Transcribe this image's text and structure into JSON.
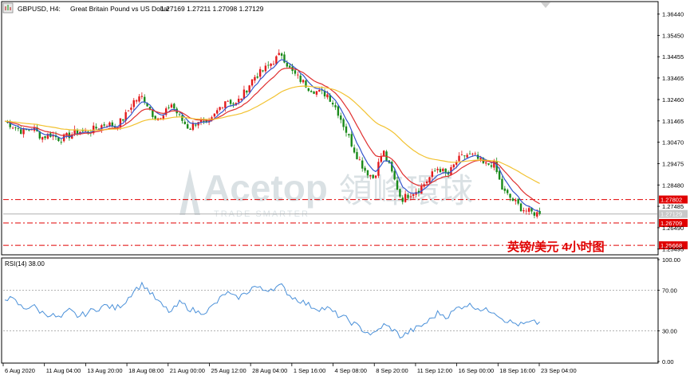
{
  "header": {
    "symbol": "GBPUSD, H4:",
    "description": "Great Britain Pound vs US Dollar",
    "ohlc": "1.27169 1.27211 1.27098 1.27129"
  },
  "watermark": {
    "brand_en": "Acetop",
    "brand_cn": "領峰環球",
    "tagline": "TRADE SMARTER"
  },
  "caption": {
    "text": "英镑/美元   4小时图",
    "color": "#e00000"
  },
  "colors": {
    "bull": "#e31a1c",
    "bear": "#1a8a1a",
    "ma_fast": "#3355cc",
    "ma_mid": "#e03030",
    "ma_slow": "#f2c230",
    "rsi": "#4a90d9",
    "level": "#e00000",
    "current": "#b0b0b0"
  },
  "chart_data": [
    {
      "type": "candlestick",
      "title": "GBPUSD, H4",
      "ylim": [
        1.253,
        1.3695
      ],
      "y_ticks": [
        "1.36440",
        "1.35450",
        "1.34455",
        "1.33465",
        "1.32460",
        "1.31465",
        "1.30470",
        "1.29475",
        "1.28480",
        "1.27485",
        "1.26490",
        "1.25495"
      ],
      "x_labels": [
        "6 Aug 2020",
        "11 Aug 04:00",
        "13 Aug 20:00",
        "18 Aug 08:00",
        "21 Aug 00:00",
        "25 Aug 12:00",
        "28 Aug 04:00",
        "1 Sep 16:00",
        "4 Sep 08:00",
        "8 Sep 20:00",
        "11 Sep 12:00",
        "16 Sep 00:00",
        "18 Sep 16:00",
        "23 Sep 04:00"
      ],
      "close_path": [
        1.3145,
        1.312,
        1.3095,
        1.3115,
        1.307,
        1.3085,
        1.306,
        1.308,
        1.31,
        1.3095,
        1.3115,
        1.3135,
        1.312,
        1.3165,
        1.324,
        1.326,
        1.318,
        1.315,
        1.323,
        1.316,
        1.311,
        1.315,
        1.312,
        1.319,
        1.325,
        1.322,
        1.328,
        1.335,
        1.338,
        1.342,
        1.346,
        1.338,
        1.334,
        1.33,
        1.328,
        1.327,
        1.32,
        1.31,
        1.3,
        1.292,
        1.288,
        1.301,
        1.29,
        1.278,
        1.281,
        1.283,
        1.288,
        1.293,
        1.289,
        1.296,
        1.299,
        1.298,
        1.294,
        1.295,
        1.282,
        1.278,
        1.274,
        1.272,
        1.2713
      ],
      "candles_count": 200,
      "moving_averages": [
        {
          "color": "blue",
          "period_note": ""
        },
        {
          "color": "red",
          "period_note": ""
        },
        {
          "color": "yellow",
          "period_note": ""
        }
      ],
      "horizontal_levels": [
        {
          "value": 1.27802,
          "label": "1.27802"
        },
        {
          "value": 1.26709,
          "label": "1.26709"
        },
        {
          "value": 1.25668,
          "label": "1.25668"
        }
      ],
      "current_price": {
        "value": 1.27129,
        "label": "1.27129"
      }
    },
    {
      "type": "line",
      "title": "RSI(14) 38.00",
      "ylim": [
        0,
        100
      ],
      "y_ticks": [
        "100.00",
        "70.00",
        "30.00",
        "0.00"
      ],
      "levels": [
        70,
        30
      ],
      "values": [
        63,
        60,
        52,
        55,
        48,
        46,
        42,
        50,
        44,
        48,
        52,
        55,
        52,
        58,
        70,
        76,
        65,
        55,
        48,
        58,
        52,
        48,
        50,
        58,
        68,
        62,
        66,
        74,
        70,
        72,
        74,
        64,
        60,
        55,
        52,
        52,
        46,
        42,
        36,
        30,
        26,
        36,
        32,
        24,
        30,
        34,
        40,
        48,
        44,
        52,
        56,
        54,
        50,
        50,
        42,
        38,
        36,
        38,
        38
      ]
    }
  ]
}
